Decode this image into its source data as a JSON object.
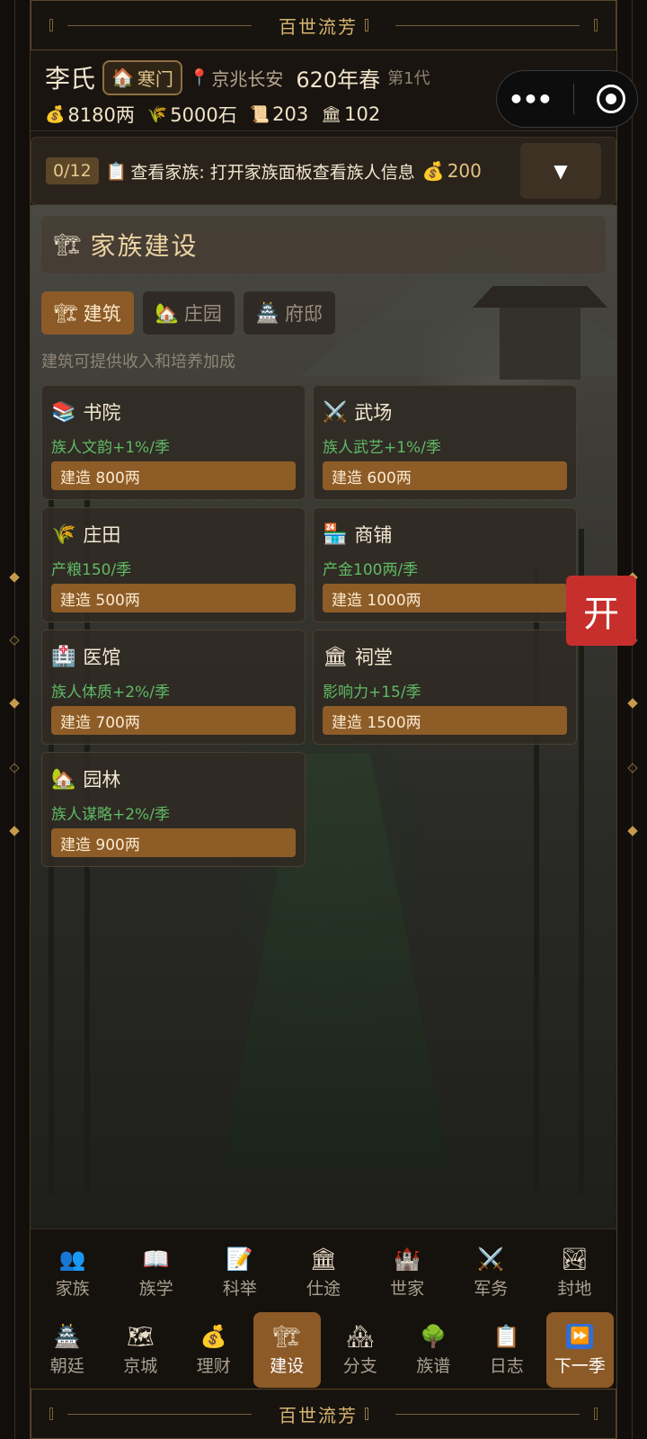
{
  "banner": {
    "title": "百世流芳"
  },
  "header": {
    "family_name": "李氏",
    "rank": "寒门",
    "location": "京兆长安",
    "season": "620年春",
    "generation": "第1代",
    "resources": [
      {
        "icon": "money-bag-icon",
        "glyph": "💰",
        "value": "8180两"
      },
      {
        "icon": "grain-icon",
        "glyph": "🌾",
        "value": "5000石"
      },
      {
        "icon": "scroll-icon",
        "glyph": "📜",
        "value": "203"
      },
      {
        "icon": "temple-icon",
        "glyph": "🏛",
        "value": "102"
      }
    ]
  },
  "capsule": {
    "more": "•••"
  },
  "task": {
    "progress": "0/12",
    "text": "查看家族: 打开家族面板查看族人信息",
    "reward": "200",
    "toggle": "▼"
  },
  "panel": {
    "title": "家族建设",
    "tabs": [
      {
        "label": "建筑",
        "glyph": "🏗",
        "active": true
      },
      {
        "label": "庄园",
        "glyph": "🏡",
        "active": false
      },
      {
        "label": "府邸",
        "glyph": "🏯",
        "active": false
      }
    ],
    "hint": "建筑可提供收入和培养加成",
    "buildings": [
      {
        "name": "书院",
        "glyph": "📚",
        "effect": "族人文韵+1%/季",
        "build": "建造 800两"
      },
      {
        "name": "武场",
        "glyph": "⚔️",
        "effect": "族人武艺+1%/季",
        "build": "建造 600两"
      },
      {
        "name": "庄田",
        "glyph": "🌾",
        "effect": "产粮150/季",
        "build": "建造 500两"
      },
      {
        "name": "商铺",
        "glyph": "🏪",
        "effect": "产金100两/季",
        "build": "建造 1000两"
      },
      {
        "name": "医馆",
        "glyph": "🏥",
        "effect": "族人体质+2%/季",
        "build": "建造 700两"
      },
      {
        "name": "祠堂",
        "glyph": "🏛",
        "effect": "影响力+15/季",
        "build": "建造 1500两"
      },
      {
        "name": "园林",
        "glyph": "🏡",
        "effect": "族人谋略+2%/季",
        "build": "建造 900两"
      }
    ]
  },
  "open_button": "开",
  "nav": {
    "row1": [
      {
        "label": "家族",
        "glyph": "👥"
      },
      {
        "label": "族学",
        "glyph": "📖"
      },
      {
        "label": "科举",
        "glyph": "📝"
      },
      {
        "label": "仕途",
        "glyph": "🏛"
      },
      {
        "label": "世家",
        "glyph": "🏰"
      },
      {
        "label": "军务",
        "glyph": "⚔️"
      },
      {
        "label": "封地",
        "glyph": "🏞"
      }
    ],
    "row2": [
      {
        "label": "朝廷",
        "glyph": "🏯"
      },
      {
        "label": "京城",
        "glyph": "🗺"
      },
      {
        "label": "理财",
        "glyph": "💰"
      },
      {
        "label": "建设",
        "glyph": "🏗",
        "active": true
      },
      {
        "label": "分支",
        "glyph": "🏘"
      },
      {
        "label": "族谱",
        "glyph": "🌳"
      },
      {
        "label": "日志",
        "glyph": "📋"
      },
      {
        "label": "下一季",
        "glyph": "⏩",
        "next": true
      }
    ]
  },
  "colors": {
    "accent": "#8c5a27",
    "effect_green": "#5fba66",
    "open_red": "#c62f2b",
    "gold": "#d8b570"
  }
}
